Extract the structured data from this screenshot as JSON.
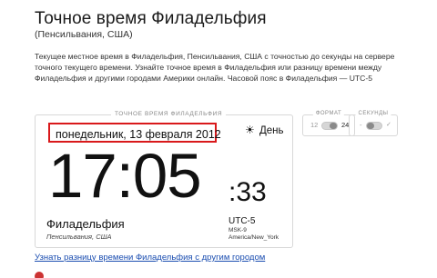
{
  "page": {
    "title": "Точное время Филадельфия",
    "subtitle": "(Пенсильвания, США)",
    "description": "Текущее местное время в Филадельфия, Пенсильвания, США с точностью до секунды на сервере точного текущего времени. Узнайте точное время в Филадельфия или разницу времени между Филадельфия и другими городами Америки онлайн. Часовой пояс в Филадельфия — UTC-5"
  },
  "clock": {
    "label": "ТОЧНОЕ ВРЕМЯ ФИЛАДЕЛЬФИЯ",
    "date": "понедельник, 13 февраля 2012",
    "day_icon": "☀",
    "day_label": "День",
    "time_hm": "17:05",
    "time_s": ":33",
    "city": "Филадельфия",
    "region": "Пенсильвания, США",
    "utc": "UTC-5",
    "msk": "MSK-9",
    "timezone": "America/New_York"
  },
  "controls": {
    "format": {
      "label": "ФОРМАТ",
      "option_12": "12",
      "option_24": "24",
      "selected": "24"
    },
    "seconds": {
      "label": "СЕКУНДЫ",
      "off_label": "-",
      "on_label": "✓",
      "enabled": false
    }
  },
  "link_text": "Узнать разницу времени Филадельфия с другим городом",
  "colors": {
    "highlight": "#d9191b",
    "link": "#1a4db0"
  }
}
